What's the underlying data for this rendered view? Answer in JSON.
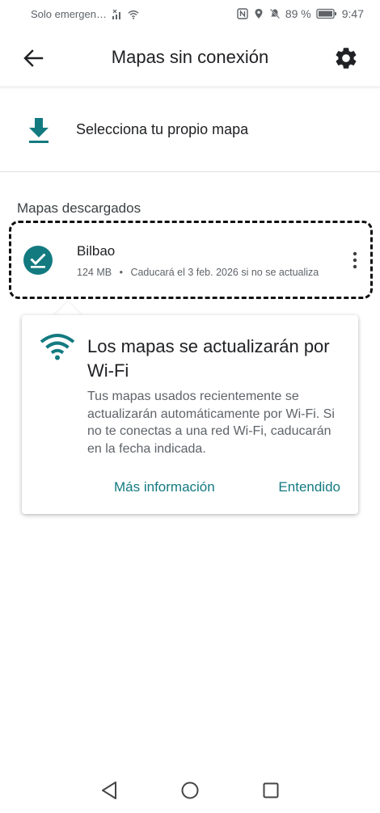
{
  "status_bar": {
    "carrier": "Solo emergen…",
    "battery": "89 %",
    "time": "9:47",
    "icons": [
      "no-signal-icon",
      "wifi-icon",
      "nfc-icon",
      "location-icon",
      "mute-icon",
      "battery-icon"
    ]
  },
  "app_bar": {
    "title": "Mapas sin conexión",
    "back_icon": "arrow-left-icon",
    "settings_icon": "gear-icon"
  },
  "select_own_map": {
    "label": "Selecciona tu propio mapa",
    "icon": "download-icon"
  },
  "downloaded": {
    "header": "Mapas descargados",
    "items": [
      {
        "name": "Bilbao",
        "size": "124 MB",
        "separator": "•",
        "expiry": "Caducará el 3 feb. 2026 si no se actualiza",
        "icon": "check-circle-icon"
      }
    ]
  },
  "tip": {
    "title": "Los mapas se actualizarán por Wi-Fi",
    "body": "Tus mapas usados recientemente se actualizarán automáticamente por Wi-Fi. Si no te conectas a una red Wi-Fi, caducarán en la fecha indicada.",
    "more_info": "Más información",
    "ok": "Entendido",
    "icon": "wifi-icon"
  },
  "colors": {
    "accent": "#137a80",
    "text_primary": "#202124",
    "text_secondary": "#5f6368"
  }
}
